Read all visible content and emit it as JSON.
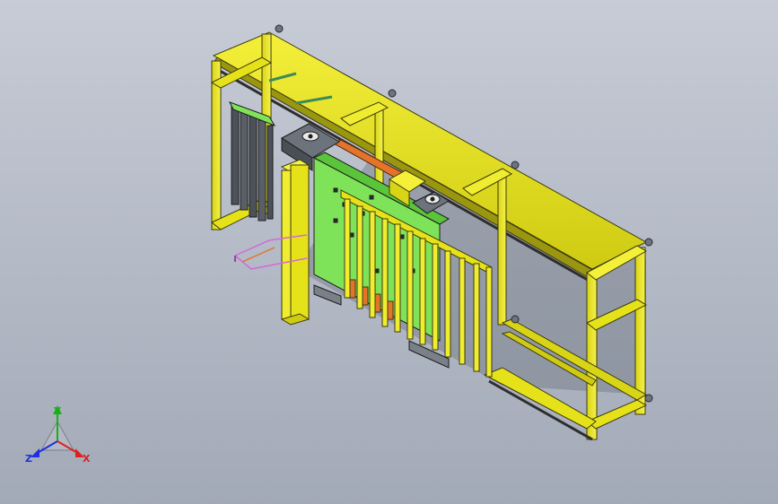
{
  "viewport": {
    "background_top": "#c7ccd6",
    "background_bottom": "#a3aab7"
  },
  "model": {
    "frame_color": "#e6e21a",
    "frame_shadow": "#9a9610",
    "panel_color": "#7fe35a",
    "dark_part_color": "#555b63",
    "orange_part_color": "#e3742a",
    "magenta_part_color": "#d06ad8"
  },
  "triad": {
    "x_label": "X",
    "y_label": "Y",
    "z_label": "Z",
    "x_color": "#e02020",
    "y_color": "#18b018",
    "z_color": "#2030e0"
  }
}
